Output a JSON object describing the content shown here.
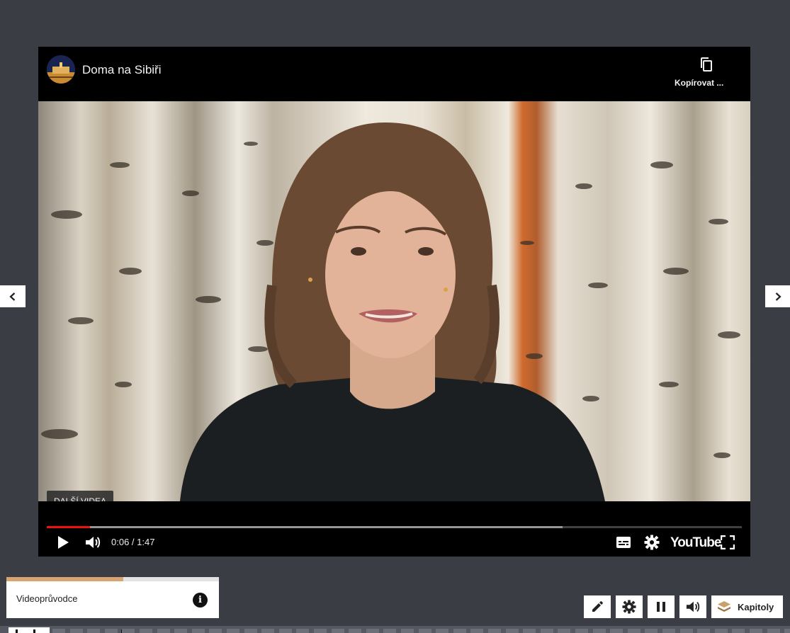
{
  "navigation": {
    "prev_icon": "chevron-left-icon",
    "next_icon": "chevron-right-icon"
  },
  "player": {
    "channel_title": "Doma na Sibiři",
    "copy_label": "Kopírovat ...",
    "copy_icon": "copy-icon",
    "more_videos_label": "DALŠÍ VIDEA",
    "time_label": "0:06 / 1:47",
    "played_fraction": 0.062,
    "buffered_fraction": 0.742,
    "logo_text": "YouTube",
    "accent_color": "#ee1111"
  },
  "guide": {
    "label": "Videoprůvodce",
    "progress_fraction": 0.55,
    "progress_color": "#d9a470",
    "info_glyph": "i"
  },
  "toolbar": {
    "chapters_label": "Kapitoly"
  }
}
